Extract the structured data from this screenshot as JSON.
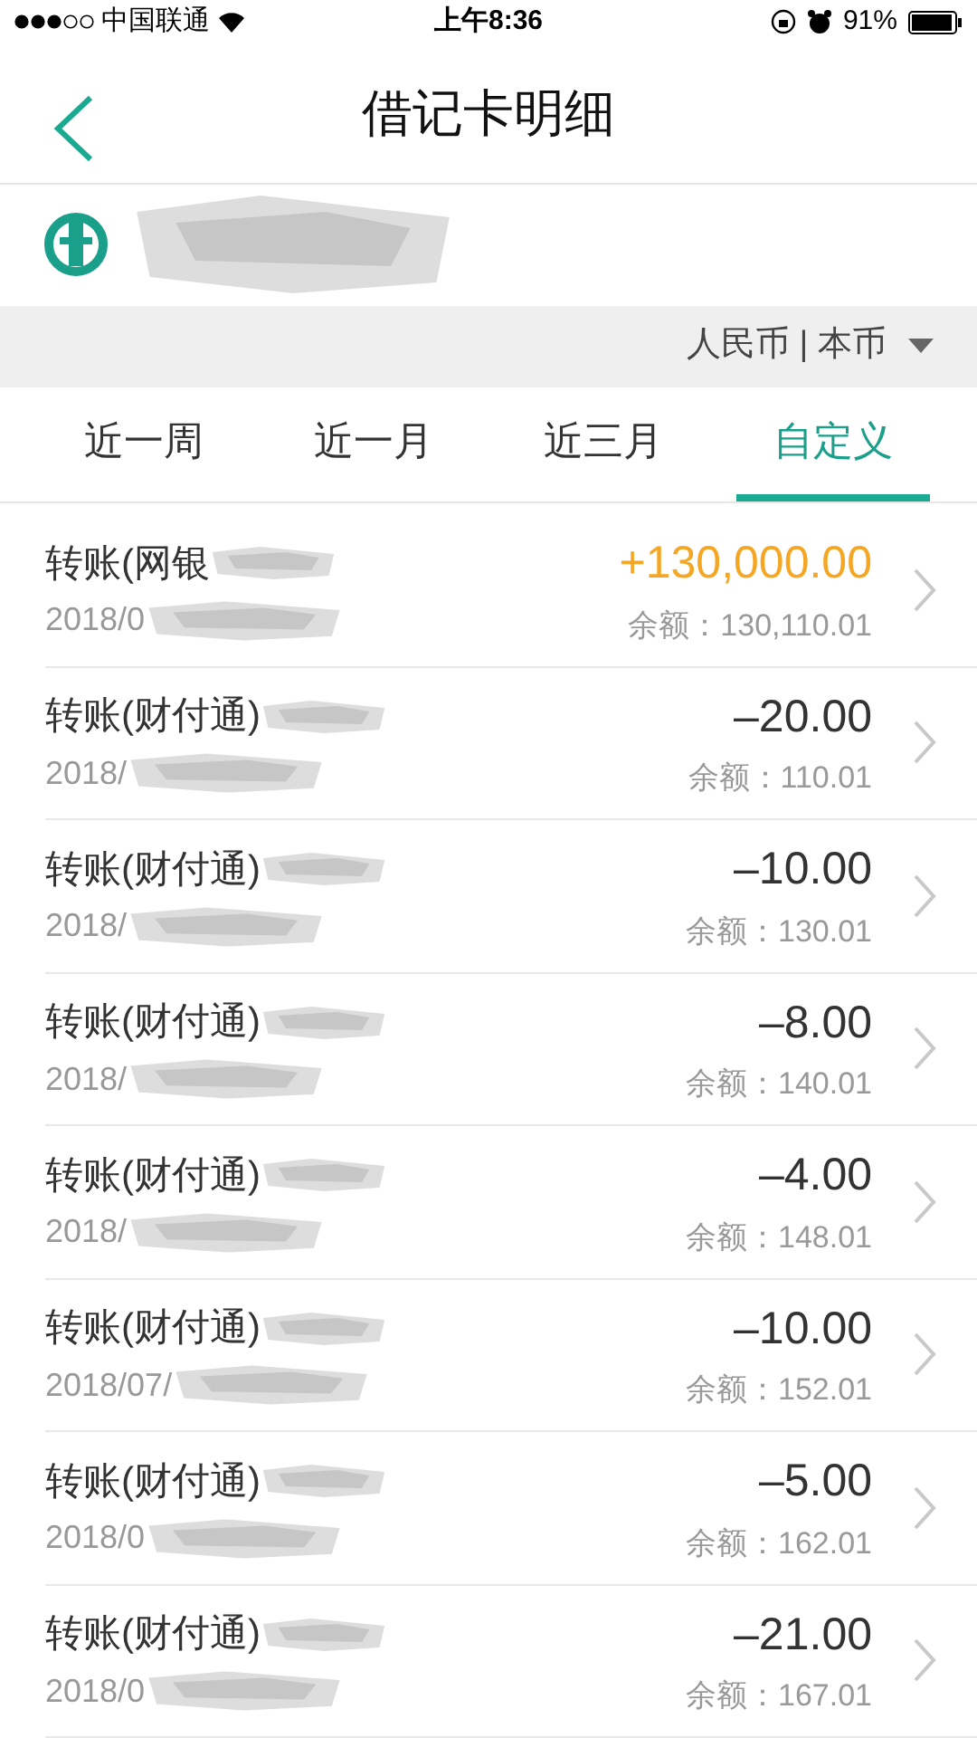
{
  "status_bar": {
    "carrier": "中国联通",
    "time": "上午8:36",
    "battery_text": "91%"
  },
  "header": {
    "title": "借记卡明细"
  },
  "currency": {
    "label": "人民币 | 本币"
  },
  "tabs": [
    {
      "label": "近一周",
      "selected": false
    },
    {
      "label": "近一月",
      "selected": false
    },
    {
      "label": "近三月",
      "selected": false
    },
    {
      "label": "自定义",
      "selected": true
    }
  ],
  "transactions": [
    {
      "title": "转账(网银",
      "date": "2018/0",
      "amount": "+130,000.00",
      "kind": "income",
      "balance": "余额：130,110.01"
    },
    {
      "title": "转账(财付通)",
      "date": "2018/",
      "amount": "–20.00",
      "kind": "expense",
      "balance": "余额：110.01"
    },
    {
      "title": "转账(财付通)",
      "date": "2018/",
      "amount": "–10.00",
      "kind": "expense",
      "balance": "余额：130.01"
    },
    {
      "title": "转账(财付通)",
      "date": "2018/",
      "amount": "–8.00",
      "kind": "expense",
      "balance": "余额：140.01"
    },
    {
      "title": "转账(财付通)",
      "date": "2018/",
      "amount": "–4.00",
      "kind": "expense",
      "balance": "余额：148.01"
    },
    {
      "title": "转账(财付通)",
      "date": "2018/07/",
      "amount": "–10.00",
      "kind": "expense",
      "balance": "余额：152.01"
    },
    {
      "title": "转账(财付通)",
      "date": "2018/0",
      "amount": "–5.00",
      "kind": "expense",
      "balance": "余额：162.01"
    },
    {
      "title": "转账(财付通)",
      "date": "2018/0",
      "amount": "–21.00",
      "kind": "expense",
      "balance": "余额：167.01"
    }
  ]
}
